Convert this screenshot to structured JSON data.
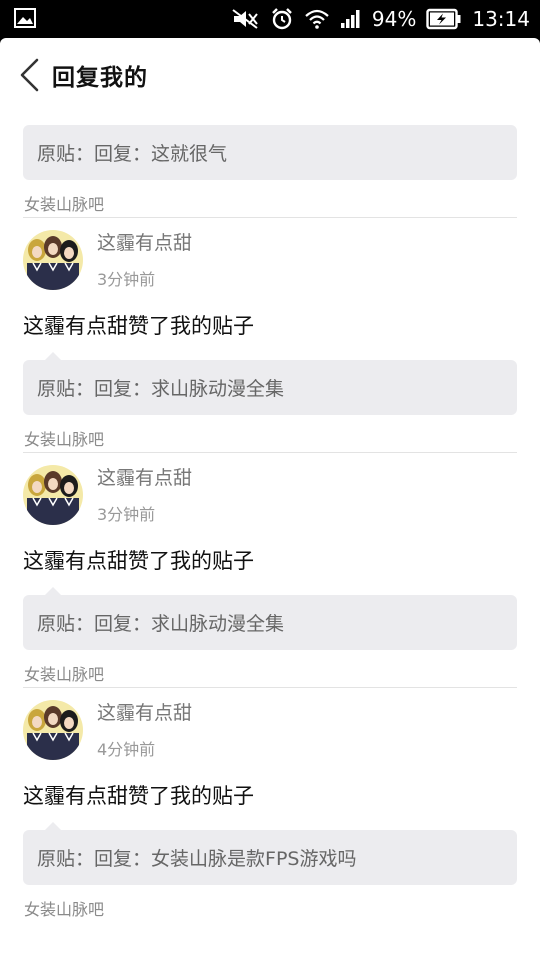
{
  "status_bar": {
    "battery": "94%",
    "time": "13:14",
    "icons": [
      "image-icon",
      "mute-icon",
      "alarm-icon",
      "wifi-icon",
      "signal-icon",
      "battery-charging-icon"
    ]
  },
  "header": {
    "title": "回复我的",
    "back_icon": "chevron-left-icon"
  },
  "colors": {
    "origin_bg": "#ececef",
    "text_primary": "#111111",
    "text_secondary": "#777777",
    "text_muted": "#8a8a8a"
  },
  "top_fragment": {
    "origin_label": "原贴：回复：",
    "origin_text": "这就很气",
    "forum": "女装山脉吧"
  },
  "notifications": [
    {
      "username": "这霾有点甜",
      "time": "3分钟前",
      "message": "这霾有点甜赞了我的贴子",
      "origin_label": "原贴：回复：",
      "origin_text": "求山脉动漫全集",
      "forum": "女装山脉吧"
    },
    {
      "username": "这霾有点甜",
      "time": "3分钟前",
      "message": "这霾有点甜赞了我的贴子",
      "origin_label": "原贴：回复：",
      "origin_text": "求山脉动漫全集",
      "forum": "女装山脉吧"
    },
    {
      "username": "这霾有点甜",
      "time": "4分钟前",
      "message": "这霾有点甜赞了我的贴子",
      "origin_label": "原贴：回复：",
      "origin_text": "女装山脉是款FPS游戏吗",
      "forum": "女装山脉吧"
    }
  ]
}
